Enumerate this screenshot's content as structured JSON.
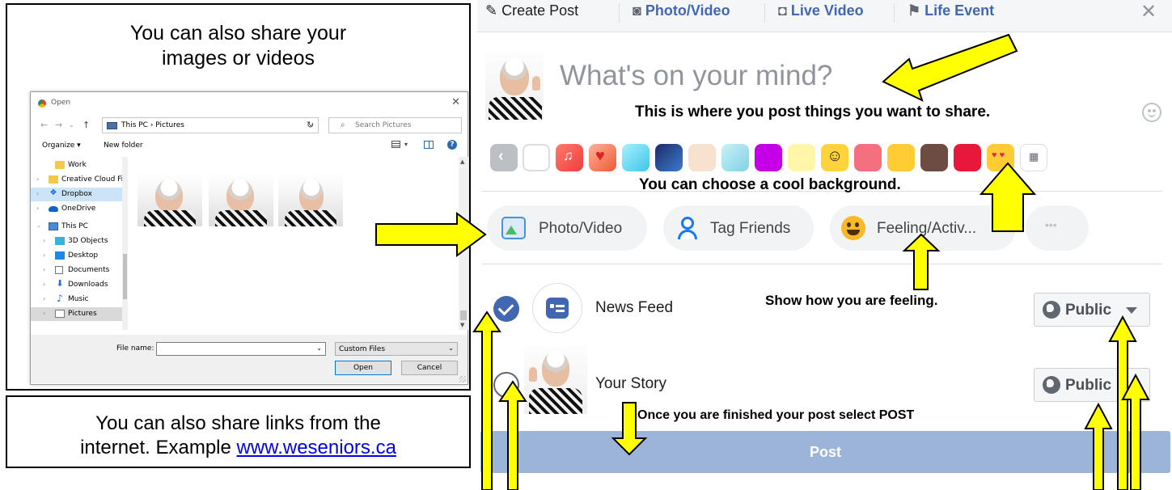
{
  "callouts": {
    "share_images": "You can also share your images or videos",
    "share_links_line1": "You can also share links from the",
    "share_links_line2_prefix": "internet. Example ",
    "share_links_url": "www.weseniors.ca"
  },
  "open_dialog": {
    "title": "Open",
    "path": "This PC  ›  Pictures",
    "path_root": "This PC",
    "path_leaf": "Pictures",
    "search_placeholder": "Search Pictures",
    "organize_label": "Organize ▾",
    "new_folder_label": "New folder",
    "tree": [
      {
        "label": "Work",
        "icon": "folder-icon"
      },
      {
        "label": "Creative Cloud Fil",
        "icon": "creative-cloud-icon"
      },
      {
        "label": "Dropbox",
        "icon": "dropbox-icon"
      },
      {
        "label": "OneDrive",
        "icon": "onedrive-icon"
      },
      {
        "label": "This PC",
        "icon": "pc-icon"
      },
      {
        "label": "3D Objects",
        "icon": "3d-objects-icon"
      },
      {
        "label": "Desktop",
        "icon": "desktop-icon"
      },
      {
        "label": "Documents",
        "icon": "documents-icon"
      },
      {
        "label": "Downloads",
        "icon": "downloads-icon"
      },
      {
        "label": "Music",
        "icon": "music-icon"
      },
      {
        "label": "Pictures",
        "icon": "pictures-icon"
      }
    ],
    "file_name_label": "File name:",
    "file_name_value": "",
    "file_type": "Custom Files",
    "open_button": "Open",
    "cancel_button": "Cancel"
  },
  "composer": {
    "tabs": {
      "create_post": "Create Post",
      "photo_video": "Photo/Video",
      "live_video": "Live Video",
      "life_event": "Life Event"
    },
    "close_icon": "close-icon",
    "placeholder": "What's on your mind?",
    "background_colors": [
      "#d8dadf",
      "#f2f3f5",
      "#f7574f",
      "#e84b3c",
      "#3ecbf0",
      "#1f3d6e",
      "#f6e0cd",
      "#a8e6f0",
      "#c600e6",
      "#fff36b",
      "#ffd43b",
      "#f05a6b",
      "#ffcc33",
      "#6d4c41",
      "#e8183a",
      "#ffcc33",
      "#ffffff"
    ],
    "actions": {
      "photo_video": "Photo/Video",
      "tag_friends": "Tag Friends",
      "feeling": "Feeling/Activ...",
      "more": "•••"
    },
    "destinations": {
      "news_feed": "News Feed",
      "your_story": "Your Story",
      "privacy": "Public"
    },
    "post_button": "Post",
    "accent": "#4267b2"
  },
  "annotations": {
    "post_here": "This is where you post things you want to share.",
    "choose_background": "You can choose a cool background.",
    "show_feeling": "Show how you are feeling.",
    "select_post": "Once you are finished your post select POST"
  }
}
